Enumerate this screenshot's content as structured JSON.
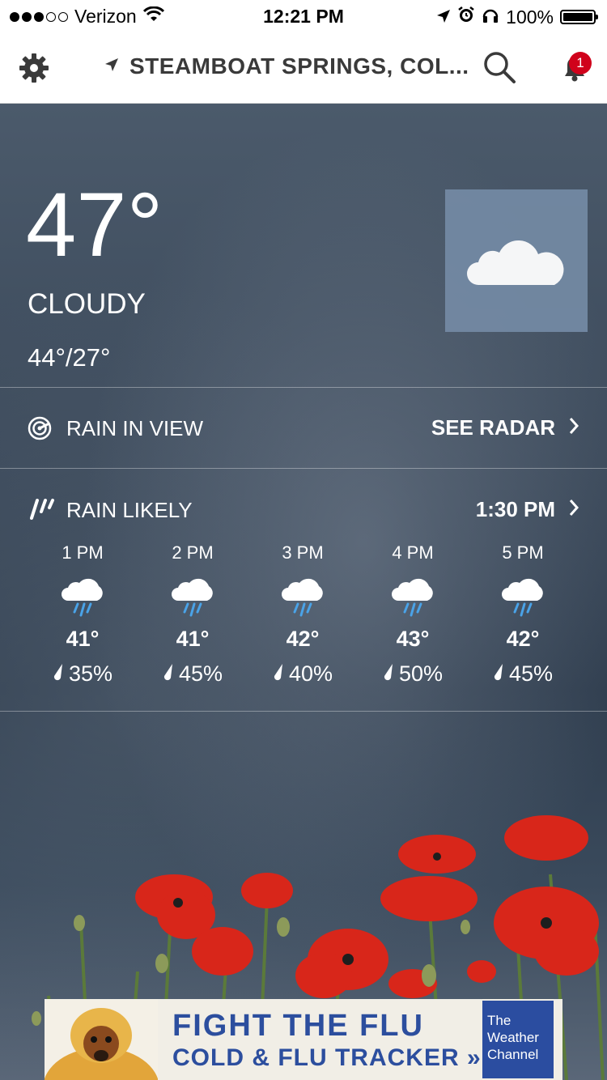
{
  "status_bar": {
    "carrier": "Verizon",
    "time": "12:21 PM",
    "battery": "100%",
    "battery_level": 1.0,
    "signal_bars_filled": 3,
    "signal_bars_total": 5
  },
  "header": {
    "location": "STEAMBOAT SPRINGS, COL...",
    "notification_count": "1",
    "icons": [
      "gear-icon",
      "location-arrow-icon",
      "search-icon",
      "bell-icon"
    ]
  },
  "current": {
    "temperature": "47°",
    "condition": "CLOUDY",
    "hi_lo": "44°/27°",
    "icon": "cloud-icon"
  },
  "radar": {
    "label": "RAIN IN VIEW",
    "link": "SEE RADAR"
  },
  "rain": {
    "label": "RAIN LIKELY",
    "time": "1:30 PM",
    "hours": [
      {
        "time": "1 PM",
        "temp": "41°",
        "pop": "35%"
      },
      {
        "time": "2 PM",
        "temp": "41°",
        "pop": "45%"
      },
      {
        "time": "3 PM",
        "temp": "42°",
        "pop": "40%"
      },
      {
        "time": "4 PM",
        "temp": "43°",
        "pop": "50%"
      },
      {
        "time": "5 PM",
        "temp": "42°",
        "pop": "45%"
      }
    ]
  },
  "ad": {
    "title": "FIGHT THE FLU",
    "subtitle": "COLD & FLU TRACKER »",
    "brand_line1": "The",
    "brand_line2": "Weather",
    "brand_line3": "Channel"
  },
  "colors": {
    "accent_badge": "#d0021b",
    "ad_blue": "#2c4e9e",
    "rain_drop": "#4aa3e8",
    "cloud_tile": "#7389a3"
  }
}
